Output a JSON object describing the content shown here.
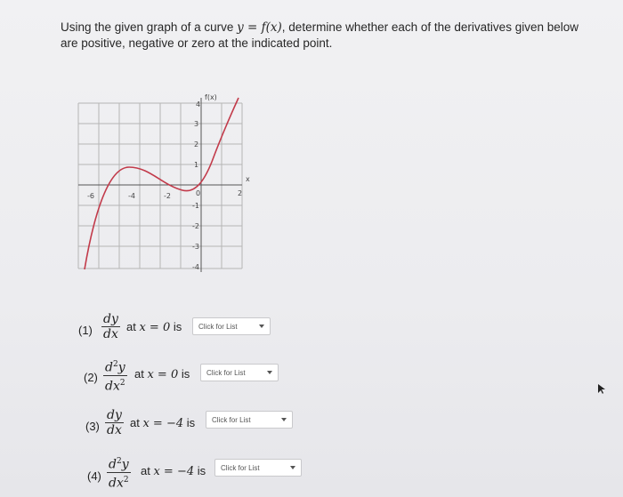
{
  "question": {
    "text_before": "Using the given graph of a curve ",
    "math_1": "y = f(x)",
    "text_after": ", determine whether each of the derivatives given below are positive, negative or zero at the indicated point."
  },
  "graph": {
    "y_axis_label": "f(x)",
    "x_axis_label": "x",
    "x_ticks": [
      "-6",
      "-4",
      "-2",
      "0",
      "2"
    ],
    "y_ticks": [
      "4",
      "3",
      "2",
      "1",
      "-1",
      "-2",
      "-3",
      "-4"
    ]
  },
  "parts": [
    {
      "number": "(1)",
      "numerator": "dy",
      "denominator": "dx",
      "order": "",
      "at_text": "at",
      "condition": "x = 0",
      "is_text": "is",
      "select_value": "Click for List"
    },
    {
      "number": "(2)",
      "numerator": "d",
      "numerator_tail": "y",
      "denominator": "dx",
      "order": "2",
      "at_text": "at",
      "condition": "x = 0",
      "is_text": "is",
      "select_value": "Click for List"
    },
    {
      "number": "(3)",
      "numerator": "dy",
      "denominator": "dx",
      "order": "",
      "at_text": "at",
      "condition": "x = −4",
      "is_text": "is",
      "select_value": "Click for List"
    },
    {
      "number": "(4)",
      "numerator": "d",
      "numerator_tail": "y",
      "denominator": "dx",
      "order": "2",
      "at_text": "at",
      "condition": "x = −4",
      "is_text": "is",
      "select_value": "Click for List"
    }
  ]
}
